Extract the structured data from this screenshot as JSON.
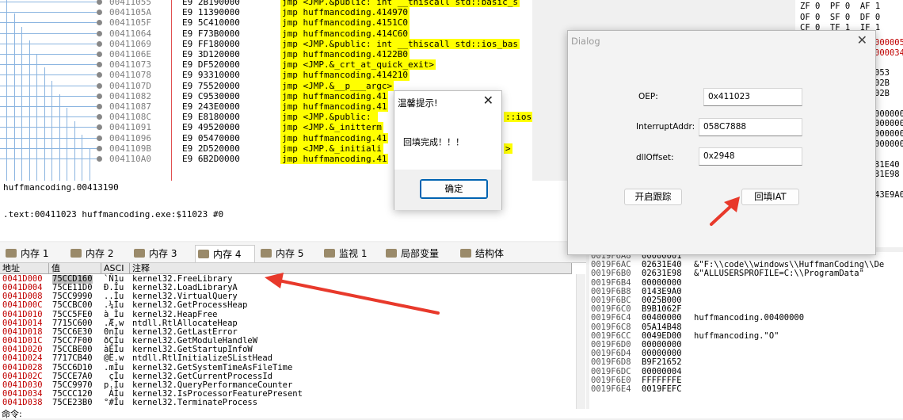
{
  "disasm": {
    "rows": [
      {
        "addr": "00411055",
        "bytes": "E9 2B190000",
        "instr": "jmp <JMP.&public: int __thiscall std::basic_s",
        "hl": true
      },
      {
        "addr": "0041105A",
        "bytes": "E9 11390000",
        "instr": "jmp huffmancoding.414970",
        "hl": true
      },
      {
        "addr": "0041105F",
        "bytes": "E9 5C410000",
        "instr": "jmp huffmancoding.4151C0",
        "hl": true
      },
      {
        "addr": "00411064",
        "bytes": "E9 F73B0000",
        "instr": "jmp huffmancoding.414C60",
        "hl": true
      },
      {
        "addr": "00411069",
        "bytes": "E9 FF180000",
        "instr": "jmp <JMP.&public: int __thiscall std::ios_bas",
        "hl": true
      },
      {
        "addr": "0041106E",
        "bytes": "E9 3D120000",
        "instr": "jmp huffmancoding.4122B0",
        "hl": true
      },
      {
        "addr": "00411073",
        "bytes": "E9 DF520000",
        "instr": "jmp <JMP.&_crt_at_quick_exit>",
        "hl": true
      },
      {
        "addr": "00411078",
        "bytes": "E9 93310000",
        "instr": "jmp huffmancoding.414210",
        "hl": true
      },
      {
        "addr": "0041107D",
        "bytes": "E9 75520000",
        "instr": "jmp <JMP.&__p___argc>",
        "hl": true
      },
      {
        "addr": "00411082",
        "bytes": "E9 C9530000",
        "instr": "jmp huffmancoding.41",
        "hl": true
      },
      {
        "addr": "00411087",
        "bytes": "E9 243E0000",
        "instr": "jmp huffmancoding.41",
        "hl": true
      },
      {
        "addr": "0041108C",
        "bytes": "E9 E8180000",
        "instr": "jmp <JMP.&public: ",
        "hl": true
      },
      {
        "addr": "00411091",
        "bytes": "E9 49520000",
        "instr": "jmp <JMP.&_initterm",
        "hl": true
      },
      {
        "addr": "00411096",
        "bytes": "E9 05470000",
        "instr": "jmp huffmancoding.41",
        "hl": true
      },
      {
        "addr": "0041109B",
        "bytes": "E9 2D520000",
        "instr": "jmp <JMP.&_initiali",
        "hl": true
      },
      {
        "addr": "004110A0",
        "bytes": "E9 6B2D0000",
        "instr": "jmp huffmancoding.41",
        "hl": true
      }
    ],
    "tail_right": {
      "r1": "::ios",
      "r2": ">"
    }
  },
  "info": {
    "line1": "huffmancoding.00413190",
    "line2": ".text:00411023 huffmancoding.exe:$11023 #0"
  },
  "tabs": [
    {
      "label": "内存 1",
      "active": false
    },
    {
      "label": "内存 2",
      "active": false
    },
    {
      "label": "内存 3",
      "active": false
    },
    {
      "label": "内存 4",
      "active": true
    },
    {
      "label": "内存 5",
      "active": false
    },
    {
      "label": "监视 1",
      "active": false
    },
    {
      "label": "局部变量",
      "active": false
    },
    {
      "label": "结构体",
      "active": false
    }
  ],
  "dump": {
    "headers": {
      "addr": "地址",
      "val": "值",
      "ascii": "ASCI",
      "comment": "注释"
    },
    "rows": [
      {
        "a": "0041D000",
        "v": "75CCD160",
        "s": "`Ñ1u",
        "c": "kernel32.FreeLibrary",
        "sel": true
      },
      {
        "a": "0041D004",
        "v": "75CE11D0",
        "s": "Ð.Îu",
        "c": "kernel32.LoadLibraryA"
      },
      {
        "a": "0041D008",
        "v": "75CC9990",
        "s": "..Ìu",
        "c": "kernel32.VirtualQuery"
      },
      {
        "a": "0041D00C",
        "v": "75CCBC00",
        "s": ".¼Ìu",
        "c": "kernel32.GetProcessHeap"
      },
      {
        "a": "0041D010",
        "v": "75CC5FE0",
        "s": "à_Ìu",
        "c": "kernel32.HeapFree"
      },
      {
        "a": "0041D014",
        "v": "7715C600",
        "s": ".Æ.w",
        "c": "ntdll.RtlAllocateHeap"
      },
      {
        "a": "0041D018",
        "v": "75CC6E30",
        "s": "0nÌu",
        "c": "kernel32.GetLastError"
      },
      {
        "a": "0041D01C",
        "v": "75CC7F00",
        "s": "ðÇÌu",
        "c": "kernel32.GetModuleHandleW"
      },
      {
        "a": "0041D020",
        "v": "75CCBE00",
        "s": "àEÌu",
        "c": "kernel32.GetStartupInfoW"
      },
      {
        "a": "0041D024",
        "v": "7717CB40",
        "s": "@Ë.w",
        "c": "ntdll.RtlInitializeSListHead"
      },
      {
        "a": "0041D028",
        "v": "75CC6D10",
        "s": ".mÌu",
        "c": "kernel32.GetSystemTimeAsFileTime"
      },
      {
        "a": "0041D02C",
        "v": "75CCE7A0",
        "s": " çÌu",
        "c": "kernel32.GetCurrentProcessId"
      },
      {
        "a": "0041D030",
        "v": "75CC9970",
        "s": "p.Ìu",
        "c": "kernel32.QueryPerformanceCounter"
      },
      {
        "a": "0041D034",
        "v": "75CCC120",
        "s": " ÁÌu",
        "c": "kernel32.IsProcessorFeaturePresent"
      },
      {
        "a": "0041D038",
        "v": "75CE23B0",
        "s": "°#Îu",
        "c": "kernel32.TerminateProcess"
      }
    ]
  },
  "stack": {
    "rows": [
      {
        "a": "0019F6A8",
        "v": "00000001",
        "c": ""
      },
      {
        "a": "0019F6AC",
        "v": "02631E40",
        "c": "&\"F:\\\\code\\\\windows\\\\HuffmanCoding\\\\De"
      },
      {
        "a": "0019F6B0",
        "v": "02631E98",
        "c": "&\"ALLUSERSPROFILE=C:\\\\ProgramData\""
      },
      {
        "a": "0019F6B4",
        "v": "00000000",
        "c": ""
      },
      {
        "a": "0019F6B8",
        "v": "0143E9A0",
        "c": ""
      },
      {
        "a": "0019F6BC",
        "v": "0025B000",
        "c": ""
      },
      {
        "a": "0019F6C0",
        "v": "B9B1062F",
        "c": ""
      },
      {
        "a": "0019F6C4",
        "v": "00400000",
        "c": "huffmancoding.00400000"
      },
      {
        "a": "0019F6C8",
        "v": "05A14B48",
        "c": ""
      },
      {
        "a": "0019F6CC",
        "v": "0049ED00",
        "c": "huffmancoding.\"O\""
      },
      {
        "a": "0019F6D0",
        "v": "00000000",
        "c": ""
      },
      {
        "a": "0019F6D4",
        "v": "00000000",
        "c": ""
      },
      {
        "a": "0019F6D8",
        "v": "B9F21652",
        "c": ""
      },
      {
        "a": "0019F6DC",
        "v": "00000004",
        "c": ""
      },
      {
        "a": "0019F6E0",
        "v": "FFFFFFFE",
        "c": ""
      },
      {
        "a": "0019F6E4",
        "v": "0019FEFC",
        "c": ""
      }
    ]
  },
  "regs": {
    "flags": [
      {
        "t": "ZF 0  PF 0  AF 1"
      },
      {
        "t": "OF 0  SF 0  DF 0"
      },
      {
        "t": "CF 0  TF 1  IF 1"
      }
    ],
    "right_frag": [
      "000005",
      "000034",
      "",
      "053",
      "02B",
      "02B",
      "",
      "000000",
      "000000",
      "000000",
      "000000",
      "",
      "31E40",
      "31E98",
      "",
      "43E9A0"
    ]
  },
  "cmd": {
    "label": "命令:"
  },
  "dialog": {
    "title": "Dialog",
    "oep_label": "OEP:",
    "oep_value": "0x411023",
    "interrupt_label": "InterruptAddr:",
    "interrupt_value": "058C7888",
    "dll_label": "dllOffset:",
    "dll_value": "0x2948",
    "start_button": "开启跟踪",
    "fill_button": "回填IAT"
  },
  "msgbox": {
    "title": "温馨提示!",
    "body": "回填完成！！！",
    "ok": "确定"
  },
  "colors": {
    "arrow": "#e8392b",
    "highlight": "#ffff00",
    "addr_red": "#c00000"
  }
}
